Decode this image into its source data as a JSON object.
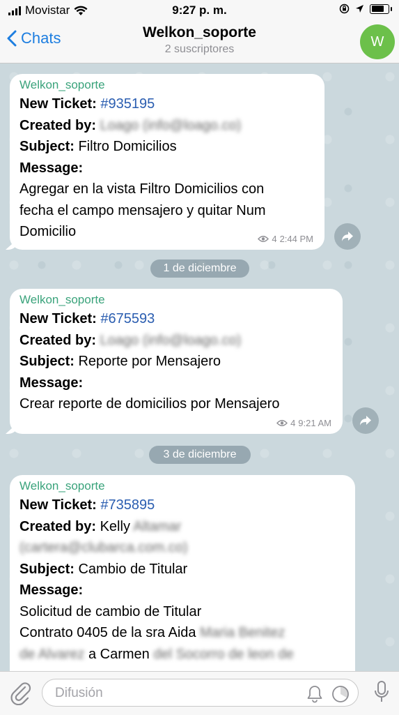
{
  "status_bar": {
    "carrier": "Movistar",
    "time": "9:27 p. m."
  },
  "header": {
    "back_label": "Chats",
    "title": "Welkon_soporte",
    "subtitle": "2 suscriptores",
    "avatar_letter": "W"
  },
  "labels": {
    "new_ticket": "New Ticket:",
    "created_by": "Created by:",
    "subject": "Subject:",
    "message": "Message:"
  },
  "messages": [
    {
      "sender": "Welkon_soporte",
      "ticket": "#935195",
      "created_by": "Loago (info@loago.co)",
      "subject": "Filtro Domicilios",
      "body_lines": [
        "Agregar en la vista Filtro Domicilios con",
        "fecha el campo mensajero y quitar Num",
        "Domicilio"
      ],
      "views": "4",
      "time": "2:44 PM"
    },
    {
      "sender": "Welkon_soporte",
      "ticket": "#675593",
      "created_by": "Loago (info@loago.co)",
      "subject": "Reporte por Mensajero",
      "body_lines": [
        "Crear reporte de domicilios por Mensajero"
      ],
      "views": "4",
      "time": "9:21 AM"
    },
    {
      "sender": "Welkon_soporte",
      "ticket": "#735895",
      "created_by_name": "Kelly",
      "created_by_hidden": "Altamar",
      "created_by_email": "(cartera@clubarca.com.co)",
      "subject": "Cambio de Titular",
      "body_line_1": "Solicitud de cambio de Titular",
      "body_line_2": "Contrato 0405 de la sra Aida",
      "body_hidden_1": "Maria Benitez",
      "body_hidden_2": "de Alvarez",
      "body_line_3": "a Carmen",
      "body_hidden_3": "del Socorro de leon de"
    }
  ],
  "date_separators": [
    "1 de diciembre",
    "3 de diciembre"
  ],
  "input": {
    "placeholder": "Difusión"
  },
  "colors": {
    "accent": "#1d7ee0",
    "sender": "#3aa37b",
    "link": "#2a5db0",
    "avatar": "#6cc04a"
  },
  "icons": [
    "wifi-icon",
    "signal-icon",
    "lock-rotation-icon",
    "location-arrow-icon",
    "battery-icon",
    "chevron-left-icon",
    "eye-icon",
    "forward-icon",
    "paperclip-icon",
    "bell-icon",
    "timer-icon",
    "microphone-icon"
  ]
}
